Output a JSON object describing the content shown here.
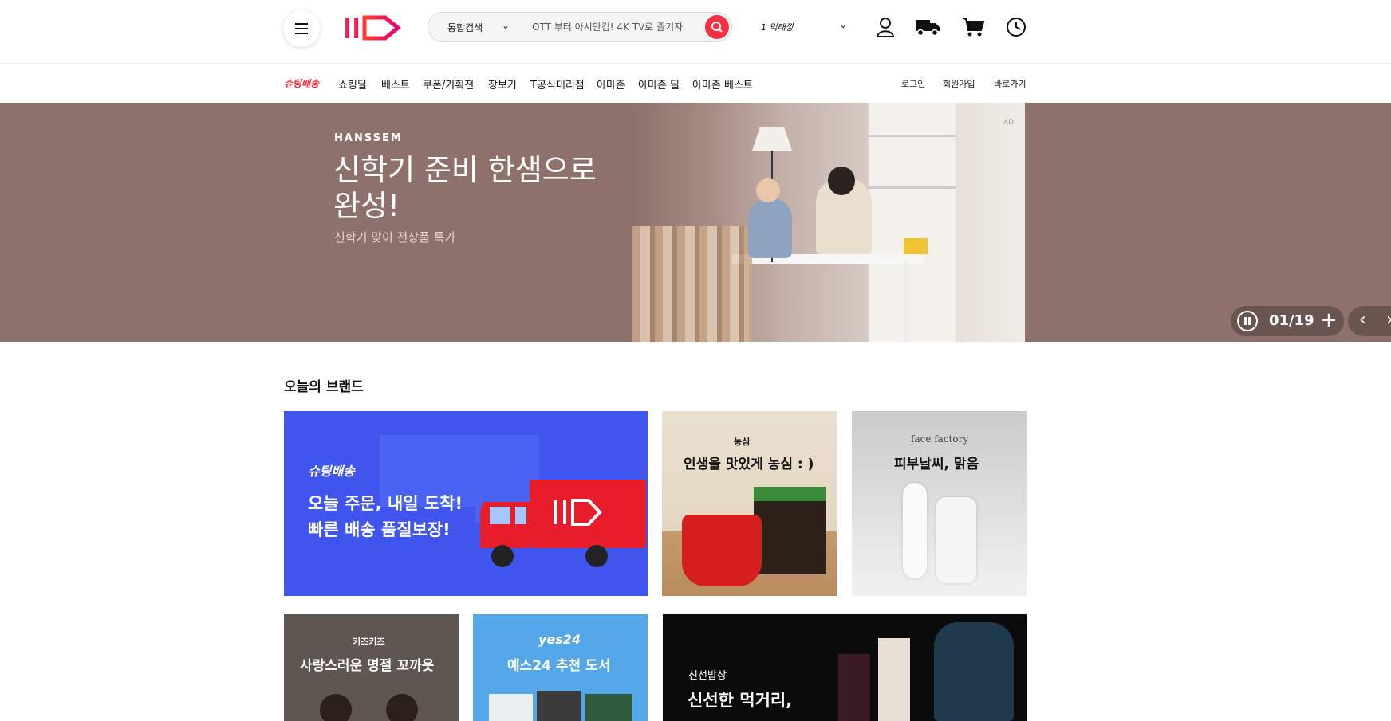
{
  "header": {
    "logo_text": "11",
    "search": {
      "category": "통합검색",
      "placeholder": "OTT 부터 아시안컵! 4K TV로 즐기자"
    },
    "rank_text": "1 먹태깡"
  },
  "nav": {
    "brand_label": "슈팅배송",
    "items": [
      "쇼킹딜",
      "베스트",
      "쿠폰/기획전",
      "장보기",
      "T공식대리점",
      "아마존",
      "아마존 딜",
      "아마존 베스트"
    ],
    "right": [
      "로그인",
      "회원가입",
      "바로가기"
    ]
  },
  "banner": {
    "brand": "HANSSEM",
    "title": "신학기 준비 한샘으로 완성!",
    "subtitle": "신학기 맞이 전상품 특가",
    "ad": "AD",
    "counter": "01/19"
  },
  "section": {
    "title": "오늘의 브랜드",
    "cards": [
      {
        "brand": "슈팅배송",
        "line1": "오늘 주문, 내일 도착!",
        "line2": "빠른 배송 품질보장!",
        "truck_logo": "11"
      },
      {
        "brand": "농심",
        "title": "인생을 맛있게 농심 : )"
      },
      {
        "brand": "face factory",
        "title": "피부날씨, 맑음"
      },
      {
        "brand": "키즈키즈",
        "title": "사랑스러운 명절 꼬까옷"
      },
      {
        "brand": "yes24",
        "title": "예스24 추천 도서"
      },
      {
        "brand": "신선밥상",
        "title": "신선한 먹거리,"
      }
    ]
  },
  "colors": {
    "accent": "#f43142",
    "banner_bg": "#8e716a",
    "shooting_blue": "#3d5af1"
  }
}
